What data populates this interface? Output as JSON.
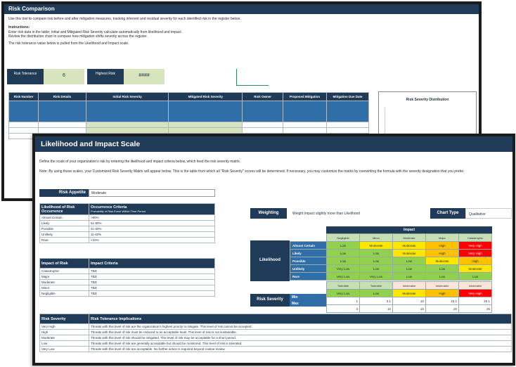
{
  "back": {
    "title": "Risk Comparison",
    "intro": "Use this tool to compare risk before and after mitigation measures, tracking inherent and residual severity for each identified risk in the register below.",
    "instructions_head": "Instructions:",
    "instruction_lines": [
      "Enter risk data in the table; Initial and Mitigated Risk Severity calculate automatically from likelihood and impact.",
      "Review the distribution chart to compare how mitigation shifts severity across the register."
    ],
    "note": "The risk tolerance value below is pulled from the Likelihood and Impact scale.",
    "risk_tolerance_label": "Risk Tolerance",
    "risk_tolerance_value": "6",
    "highest_risk_label": "Highest Risk",
    "highest_risk_value": "####",
    "columns": [
      "Risk Number",
      "Risk Details",
      "Initial Risk Severity",
      "Mitigated Risk Severity",
      "Risk Owner",
      "Proposed Mitigation",
      "Mitigation Due Date"
    ],
    "chart_title": "Risk Severity Distribution"
  },
  "front": {
    "title": "Likelihood and Impact Scale",
    "intro_1": "Define the scale of your organization's risk by entering the likelihood and impact criteria below, which feed the risk severity matrix.",
    "intro_2": "Note: By using these scales, your Customized Risk Severity Matrix will appear below. This is the table from which all \"Risk Severity\" scores will be determined. If necessary, you may customize the matrix by overwriting the formula with the severity designation that you prefer.",
    "appetite_label": "Risk Appetite",
    "appetite_value": "Moderate",
    "likelihood_table": {
      "col1": "Likelihood of Risk Occurrence",
      "col2": "Occurrence Criteria",
      "col2_sub": "Probability of Risk Event Within Time Period",
      "rows": [
        {
          "level": "Almost Certain",
          "value": ">90%"
        },
        {
          "level": "Likely",
          "value": "61-90%"
        },
        {
          "level": "Possible",
          "value": "41-60%"
        },
        {
          "level": "Unlikely",
          "value": "11-40%"
        },
        {
          "level": "Rare",
          "value": "<10%"
        }
      ]
    },
    "impact_table": {
      "col1": "Impact of Risk",
      "col2": "Impact Criteria",
      "rows": [
        {
          "level": "Catastrophic",
          "value": "TBD"
        },
        {
          "level": "Major",
          "value": "TBD"
        },
        {
          "level": "Moderate",
          "value": "TBD"
        },
        {
          "level": "Minor",
          "value": "TBD"
        },
        {
          "level": "Negligible",
          "value": "TBD"
        }
      ]
    },
    "weighting_label": "Weighting",
    "weighting_value": "Weight impact slightly more than Likelihood",
    "chart_type_label": "Chart Type",
    "chart_type_value": "Qualitative",
    "matrix": {
      "impact_header": "Impact",
      "likelihood_header": "Likelihood",
      "impact_levels": [
        "Negligible",
        "Minor",
        "Moderate",
        "Major",
        "Catastrophic"
      ],
      "rows": [
        {
          "level": "Almost Certain",
          "cells": [
            "Low",
            "Moderate",
            "Moderate",
            "High",
            "Very High"
          ]
        },
        {
          "level": "Likely",
          "cells": [
            "Low",
            "Low",
            "Moderate",
            "High",
            "Very High"
          ]
        },
        {
          "level": "Possible",
          "cells": [
            "Low",
            "Low",
            "Low",
            "Moderate",
            "High"
          ]
        },
        {
          "level": "Unlikely",
          "cells": [
            "Very Low",
            "Low",
            "Low",
            "Low",
            "Moderate"
          ]
        },
        {
          "level": "Rare",
          "cells": [
            "Very Low",
            "Very Low",
            "Low",
            "Low",
            "Low"
          ]
        }
      ]
    },
    "severity": {
      "label": "Risk Severity",
      "tolerance_labels": [
        "Tolerable",
        "Tolerable",
        "Intolerable",
        "Intolerable",
        "Intolerable"
      ],
      "levels": [
        "Very Low",
        "Low",
        "Moderate",
        "High",
        "Very High"
      ],
      "min_label": "Min",
      "max_label": "Max",
      "min": [
        "1",
        "3.1",
        "10",
        "15.1",
        "20.1"
      ],
      "max": [
        "3",
        "10",
        "15",
        "20",
        "25"
      ]
    },
    "tolerance_table": {
      "col1": "Risk Severity",
      "col2": "Risk Tolerance Implications",
      "rows": [
        {
          "level": "Very High",
          "text": "Threats with this level of risk are the organization's highest priority to mitigate. This level of risk cannot be accepted."
        },
        {
          "level": "High",
          "text": "Threats with this level of risk must be reduced to an acceptable level. This level of risk is not sustainable."
        },
        {
          "level": "Moderate",
          "text": "Threats with this level of risk should be mitigated. This level of risk may be acceptable for a short period."
        },
        {
          "level": "Low",
          "text": "Threats with this level of risk are generally acceptable but should be monitored. This level of risk is tolerated."
        },
        {
          "level": "Very Low",
          "text": "Threats with this level of risk are acceptable. No further action is required beyond routine review."
        }
      ]
    }
  }
}
